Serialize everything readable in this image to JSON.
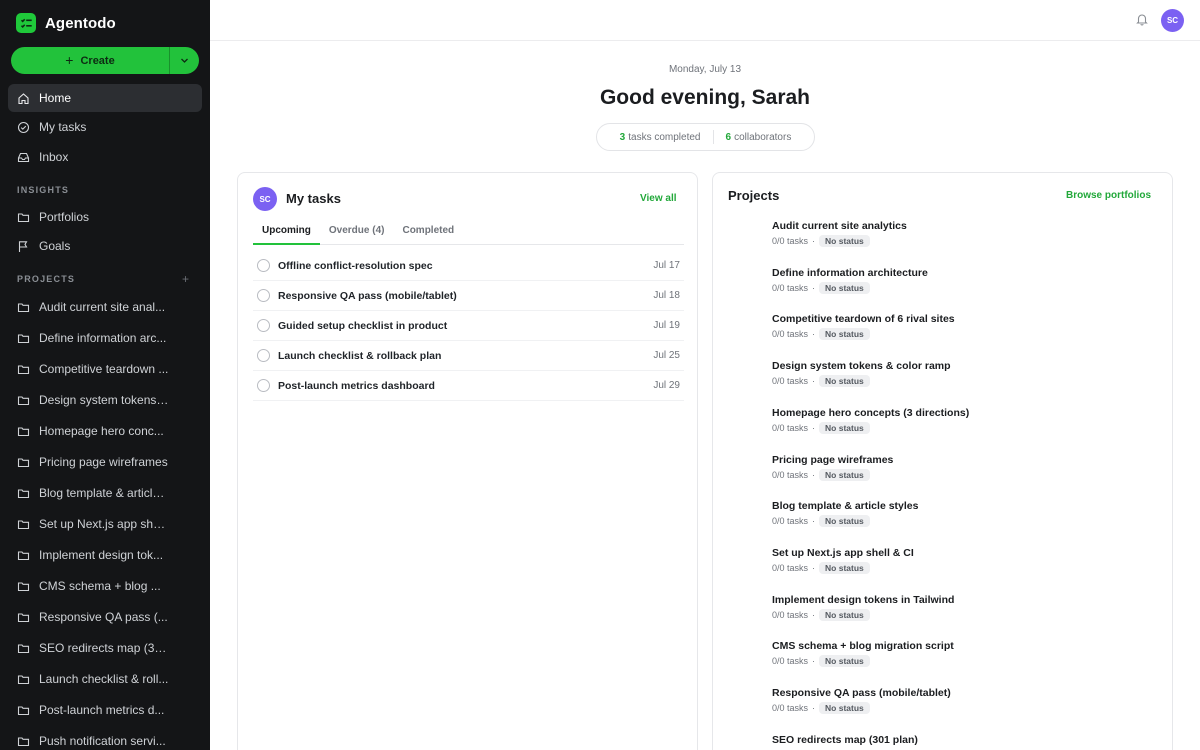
{
  "app": {
    "name": "Agentodo"
  },
  "create": {
    "label": "Create"
  },
  "nav": [
    {
      "label": "Home",
      "icon": "home-icon"
    },
    {
      "label": "My tasks",
      "icon": "check-circle-icon"
    },
    {
      "label": "Inbox",
      "icon": "inbox-icon"
    }
  ],
  "insights": {
    "heading": "INSIGHTS",
    "items": [
      {
        "label": "Portfolios",
        "icon": "folder-icon"
      },
      {
        "label": "Goals",
        "icon": "flag-icon"
      }
    ]
  },
  "projects_section": {
    "heading": "PROJECTS",
    "add": "+",
    "items": [
      "Audit current site anal...",
      "Define information arc...",
      "Competitive teardown ...",
      "Design system tokens ...",
      "Homepage hero conc...",
      "Pricing page wireframes",
      "Blog template & article...",
      "Set up Next.js app she...",
      "Implement design tok...",
      "CMS schema + blog ...",
      "Responsive QA pass (...",
      "SEO redirects map (30...",
      "Launch checklist & roll...",
      "Post-launch metrics d...",
      "Push notification servi..."
    ]
  },
  "topbar": {
    "avatar_initials": "SC"
  },
  "header": {
    "date": "Monday, July 13",
    "greeting": "Good evening, Sarah",
    "stats": [
      {
        "value": "3",
        "label": "tasks completed"
      },
      {
        "value": "6",
        "label": "collaborators"
      }
    ]
  },
  "my_tasks": {
    "avatar_initials": "SC",
    "title": "My tasks",
    "view_all": "View all",
    "tabs": [
      "Upcoming",
      "Overdue (4)",
      "Completed"
    ],
    "tasks": [
      {
        "name": "Offline conflict-resolution spec",
        "date": "Jul 17"
      },
      {
        "name": "Responsive QA pass (mobile/tablet)",
        "date": "Jul 18"
      },
      {
        "name": "Guided setup checklist in product",
        "date": "Jul 19"
      },
      {
        "name": "Launch checklist & rollback plan",
        "date": "Jul 25"
      },
      {
        "name": "Post-launch metrics dashboard",
        "date": "Jul 29"
      }
    ]
  },
  "projects_card": {
    "title": "Projects",
    "link": "Browse portfolios",
    "items": [
      {
        "name": "Audit current site analytics",
        "tasks": "0/0 tasks",
        "status": "No status"
      },
      {
        "name": "Define information architecture",
        "tasks": "0/0 tasks",
        "status": "No status"
      },
      {
        "name": "Competitive teardown of 6 rival sites",
        "tasks": "0/0 tasks",
        "status": "No status"
      },
      {
        "name": "Design system tokens & color ramp",
        "tasks": "0/0 tasks",
        "status": "No status"
      },
      {
        "name": "Homepage hero concepts (3 directions)",
        "tasks": "0/0 tasks",
        "status": "No status"
      },
      {
        "name": "Pricing page wireframes",
        "tasks": "0/0 tasks",
        "status": "No status"
      },
      {
        "name": "Blog template & article styles",
        "tasks": "0/0 tasks",
        "status": "No status"
      },
      {
        "name": "Set up Next.js app shell & CI",
        "tasks": "0/0 tasks",
        "status": "No status"
      },
      {
        "name": "Implement design tokens in Tailwind",
        "tasks": "0/0 tasks",
        "status": "No status"
      },
      {
        "name": "CMS schema + blog migration script",
        "tasks": "0/0 tasks",
        "status": "No status"
      },
      {
        "name": "Responsive QA pass (mobile/tablet)",
        "tasks": "0/0 tasks",
        "status": "No status"
      },
      {
        "name": "SEO redirects map (301 plan)",
        "tasks": "",
        "status": ""
      }
    ]
  },
  "colors": {
    "accent": "#22c23b",
    "avatar": "#7b61f2",
    "sidebar_bg": "#141517"
  }
}
